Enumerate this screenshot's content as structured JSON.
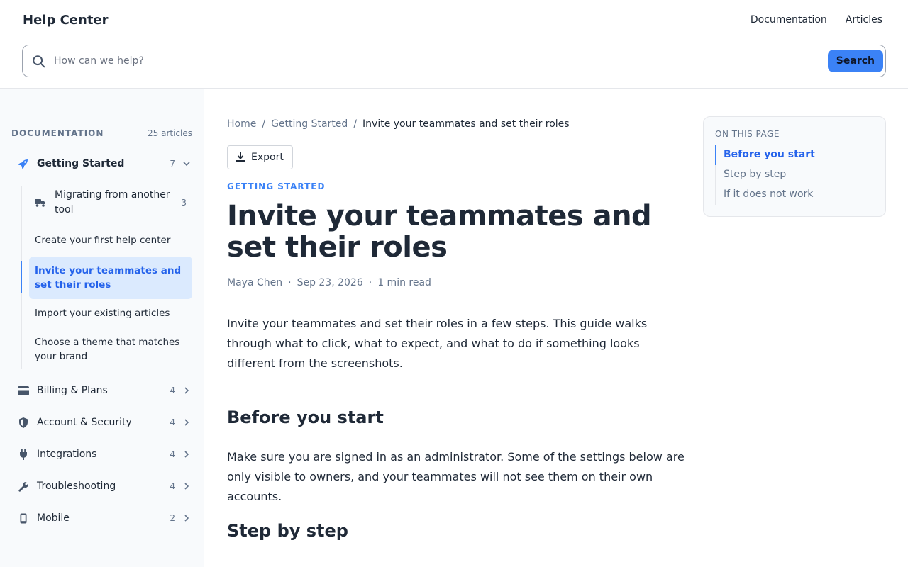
{
  "header": {
    "brand": "Help Center",
    "nav": [
      "Documentation",
      "Articles"
    ],
    "search_placeholder": "How can we help?",
    "search_button": "Search"
  },
  "sidebar": {
    "title": "DOCUMENTATION",
    "count": "25 articles",
    "getting_started": {
      "label": "Getting Started",
      "count": "7",
      "icon": "rocket-icon"
    },
    "migrating": {
      "label": "Migrating from another tool",
      "count": "3",
      "icon": "truck-icon"
    },
    "articles": [
      "Create your first help center",
      "Invite your teammates and set their roles",
      "Import your existing articles",
      "Choose a theme that matches your brand"
    ],
    "categories": [
      {
        "label": "Billing & Plans",
        "count": "4",
        "icon": "credit-card-icon"
      },
      {
        "label": "Account & Security",
        "count": "4",
        "icon": "shield-icon"
      },
      {
        "label": "Integrations",
        "count": "4",
        "icon": "plug-icon"
      },
      {
        "label": "Troubleshooting",
        "count": "4",
        "icon": "wrench-icon"
      },
      {
        "label": "Mobile",
        "count": "2",
        "icon": "phone-icon"
      }
    ]
  },
  "main": {
    "breadcrumb": [
      "Home",
      "Getting Started",
      "Invite your teammates and set their roles"
    ],
    "export_label": "Export",
    "kicker": "GETTING STARTED",
    "title": "Invite your teammates and set their roles",
    "author": "Maya Chen",
    "date": "Sep 23, 2026",
    "read_time": "1 min read",
    "intro": "Invite your teammates and set their roles in a few steps. This guide walks through what to click, what to expect, and what to do if something looks different from the screenshots.",
    "section1_title": "Before you start",
    "section1_body": "Make sure you are signed in as an administrator. Some of the settings below are only visible to owners, and your teammates will not see them on their own accounts.",
    "section2_title": "Step by step"
  },
  "toc": {
    "title": "ON THIS PAGE",
    "items": [
      "Before you start",
      "Step by step",
      "If it does not work"
    ]
  },
  "colors": {
    "accent": "#3b82f6",
    "active_bg": "#dbeafe",
    "text": "#1f2937",
    "muted": "#64748b"
  }
}
